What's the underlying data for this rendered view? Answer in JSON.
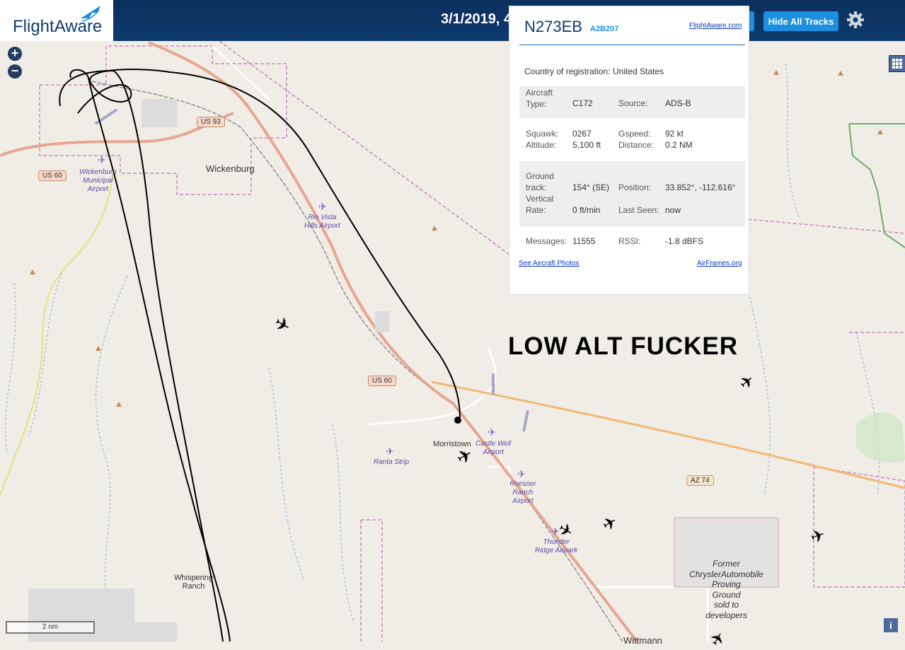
{
  "header": {
    "logo": "FlightAware",
    "date": "3/1/2019, 4",
    "hide_tracks": "Hide All Tracks"
  },
  "map": {
    "places": {
      "wickenburg": "Wickenburg",
      "morristown": "Morristown",
      "whispering": "Whispering\nRanch",
      "wittmann": "Wittmann"
    },
    "airports": {
      "wickenburg": "Wickenburg\nMunicipal\nAirport",
      "rio_vista": "Rio Vista\nHills Airport",
      "castle_well": "Castle Well\nAirport",
      "ranta": "Ranta Strip",
      "roesner": "Roesner\nRanch\nAirport",
      "thunder": "Thunder\nRidge Airpark"
    },
    "roads": {
      "us93": "US 93",
      "us60a": "US 60",
      "us60b": "US 60",
      "az74": "AZ 74"
    },
    "proving_ground": "Former\nChryslerAutomobile\nProving\nGround\nsold to\ndevelopers",
    "scale": "2 nm",
    "info": "i"
  },
  "popup": {
    "callsign": "N273EB",
    "hex": "A2B207",
    "link_fa": "FlightAware.com",
    "country_label": "Country of registration:",
    "country_value": "United States",
    "aircraft_type_label": "Aircraft\nType:",
    "aircraft_type_value": "C172",
    "source_label": "Source:",
    "source_value": "ADS-B",
    "squawk_label": "Squawk:",
    "squawk_value": "0267",
    "altitude_label": "Altitude:",
    "altitude_value": "5,100 ft",
    "gspeed_label": "Gspeed:",
    "gspeed_value": "92 kt",
    "distance_label": "Distance:",
    "distance_value": "0.2 NM",
    "ground_track_label": "Ground\ntrack:",
    "ground_track_value": "154° (SE)",
    "position_label": "Position:",
    "position_value": "33.852°, -112.616°",
    "vrate_label": "Vertical\nRate:",
    "vrate_value": "0 ft/min",
    "last_seen_label": "Last Seen:",
    "last_seen_value": "now",
    "messages_label": "Messages:",
    "messages_value": "11555",
    "rssi_label": "RSSI:",
    "rssi_value": "-1.8 dBFS",
    "photos_link": "See Aircraft Photos",
    "airframes_link": "AirFrames.org"
  },
  "overlay_text": "LOW ALT FUCKER"
}
